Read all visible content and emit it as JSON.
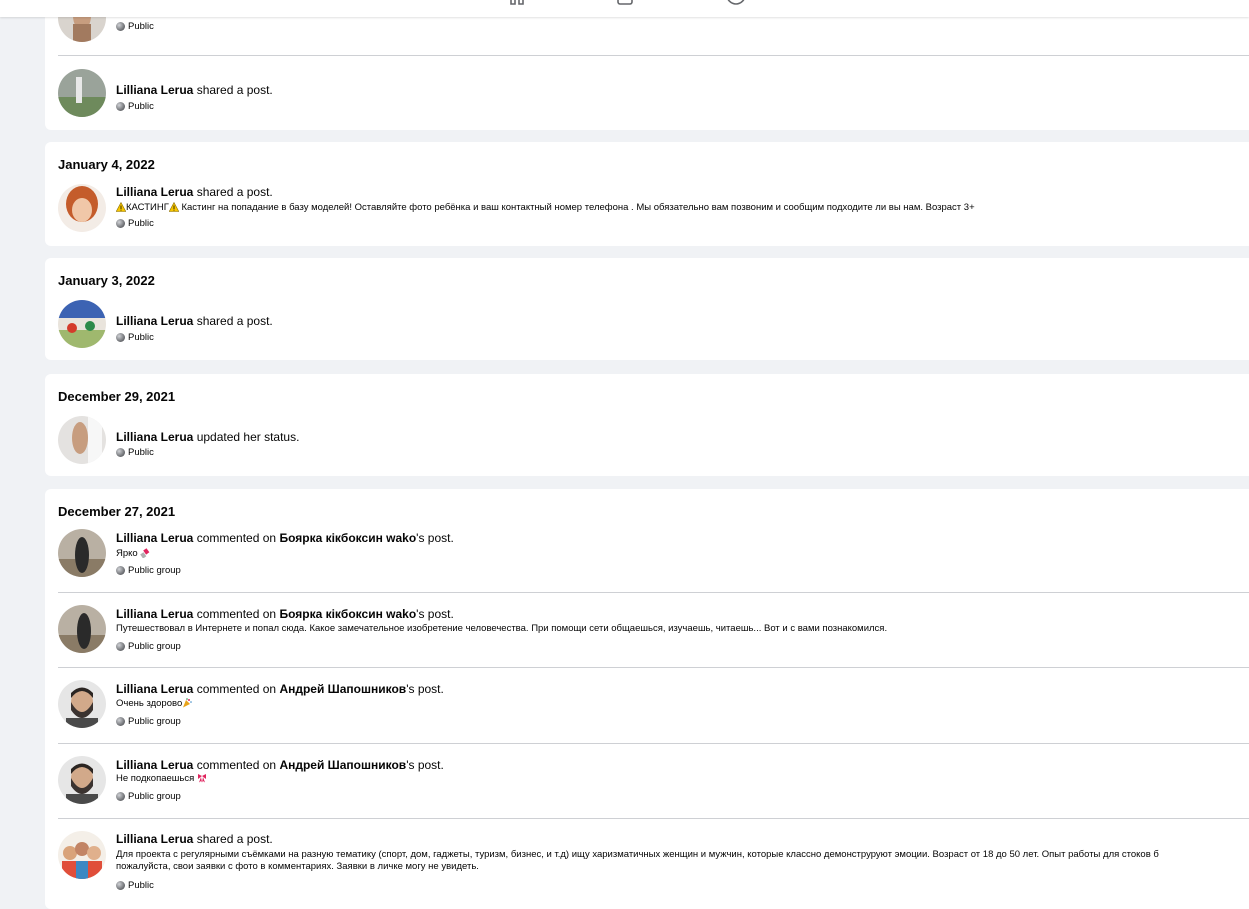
{
  "colors": {
    "page_bg": "#f0f2f5",
    "card_bg": "#ffffff",
    "divider": "#ced0d4",
    "text": "#050505"
  },
  "top_nav": {
    "icons": [
      "home-icon",
      "video-icon",
      "clock-icon"
    ]
  },
  "feed": {
    "partial_top": {
      "row1": {
        "audience": "Public"
      },
      "row2": {
        "actor": "Lilliana Lerua",
        "action": "shared a post.",
        "audience": "Public"
      }
    },
    "jan4": {
      "date": "January 4, 2022",
      "row1": {
        "actor": "Lilliana Lerua",
        "action": "shared a post.",
        "body_prefix": "КАСТИНГ",
        "body_rest": " Кастинг на попадание в базу моделей! Оставляйте фото ребёнка и ваш контактный номер телефона . Мы обязательно вам позвоним и сообщим подходите ли вы нам. Возраст 3+",
        "audience": "Public"
      }
    },
    "jan3": {
      "date": "January 3, 2022",
      "row1": {
        "actor": "Lilliana Lerua",
        "action": "shared a post.",
        "audience": "Public"
      }
    },
    "dec29": {
      "date": "December 29, 2021",
      "row1": {
        "actor": "Lilliana Lerua",
        "action": "updated her status.",
        "audience": "Public"
      }
    },
    "dec27": {
      "date": "December 27, 2021",
      "row1": {
        "actor": "Lilliana Lerua",
        "action_pre": "commented on",
        "target": "Боярка кікбоксин wako",
        "action_post": "'s post.",
        "body": "Ярко",
        "audience": "Public group"
      },
      "row2": {
        "actor": "Lilliana Lerua",
        "action_pre": "commented on",
        "target": "Боярка кікбоксин wako",
        "action_post": "'s post.",
        "body": "Путешествовал в Интернете и попал сюда. Какое замечательное изобретение человечества. При помощи сети общаешься, изучаешь, читаешь... Вот и с вами познакомился.",
        "audience": "Public group"
      },
      "row3": {
        "actor": "Lilliana Lerua",
        "action_pre": "commented on",
        "target": "Андрей Шапошников",
        "action_post": "'s post.",
        "body": "Очень здорово",
        "audience": "Public group"
      },
      "row4": {
        "actor": "Lilliana Lerua",
        "action_pre": "commented on",
        "target": "Андрей Шапошников",
        "action_post": "'s post.",
        "body": "Не подкопаешься",
        "audience": "Public group"
      },
      "row5": {
        "actor": "Lilliana Lerua",
        "action": "shared a post.",
        "body_line1": "Для проекта с регулярными съёмками на разную тематику (спорт, дом, гаджеты, туризм, бизнес, и т.д) ищу харизматичных женщин и мужчин, которые классно демонструруют эмоции. Возраст от 18 до 50 лет. Опыт работы для стоков б",
        "body_line2": "пожалуйста, свои заявки с фото в комментариях. Заявки в личке могу не увидеть.",
        "audience": "Public"
      }
    }
  }
}
